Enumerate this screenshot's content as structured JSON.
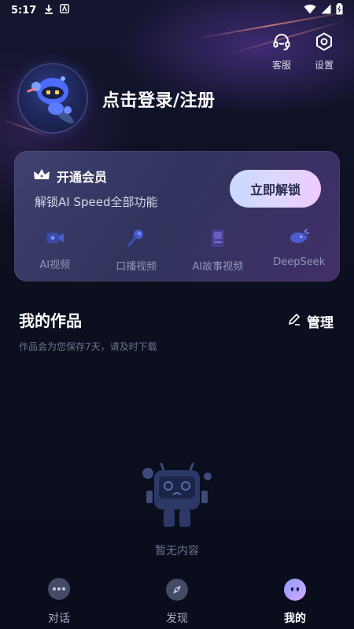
{
  "status_bar": {
    "time": "5:17"
  },
  "top_actions": {
    "service_label": "客服",
    "settings_label": "设置"
  },
  "profile": {
    "login_text": "点击登录/注册"
  },
  "vip": {
    "title": "开通会员",
    "subtitle": "解锁AI Speed全部功能",
    "unlock_button": "立即解锁",
    "features": [
      {
        "label": "AI视频",
        "icon": "video-camera-icon"
      },
      {
        "label": "口播视频",
        "icon": "microphone-icon"
      },
      {
        "label": "AI故事视频",
        "icon": "book-icon"
      },
      {
        "label": "DeepSeek",
        "icon": "deepseek-whale-icon"
      }
    ]
  },
  "works": {
    "title": "我的作品",
    "manage_label": "管理",
    "hint": "作品会为您保存7天，请及时下载",
    "empty_text": "暂无内容"
  },
  "bottom_nav": {
    "items": [
      {
        "label": "对话",
        "icon": "chat-bubble-icon"
      },
      {
        "label": "发现",
        "icon": "compass-icon"
      },
      {
        "label": "我的",
        "icon": "mascot-face-icon"
      }
    ],
    "active_index": 2
  },
  "colors": {
    "background": "#0c1020",
    "card_start": "#46487a",
    "button_gradient_start": "#c9d9ff",
    "button_gradient_end": "#f0c9ff",
    "muted_text": "#6a708c"
  }
}
